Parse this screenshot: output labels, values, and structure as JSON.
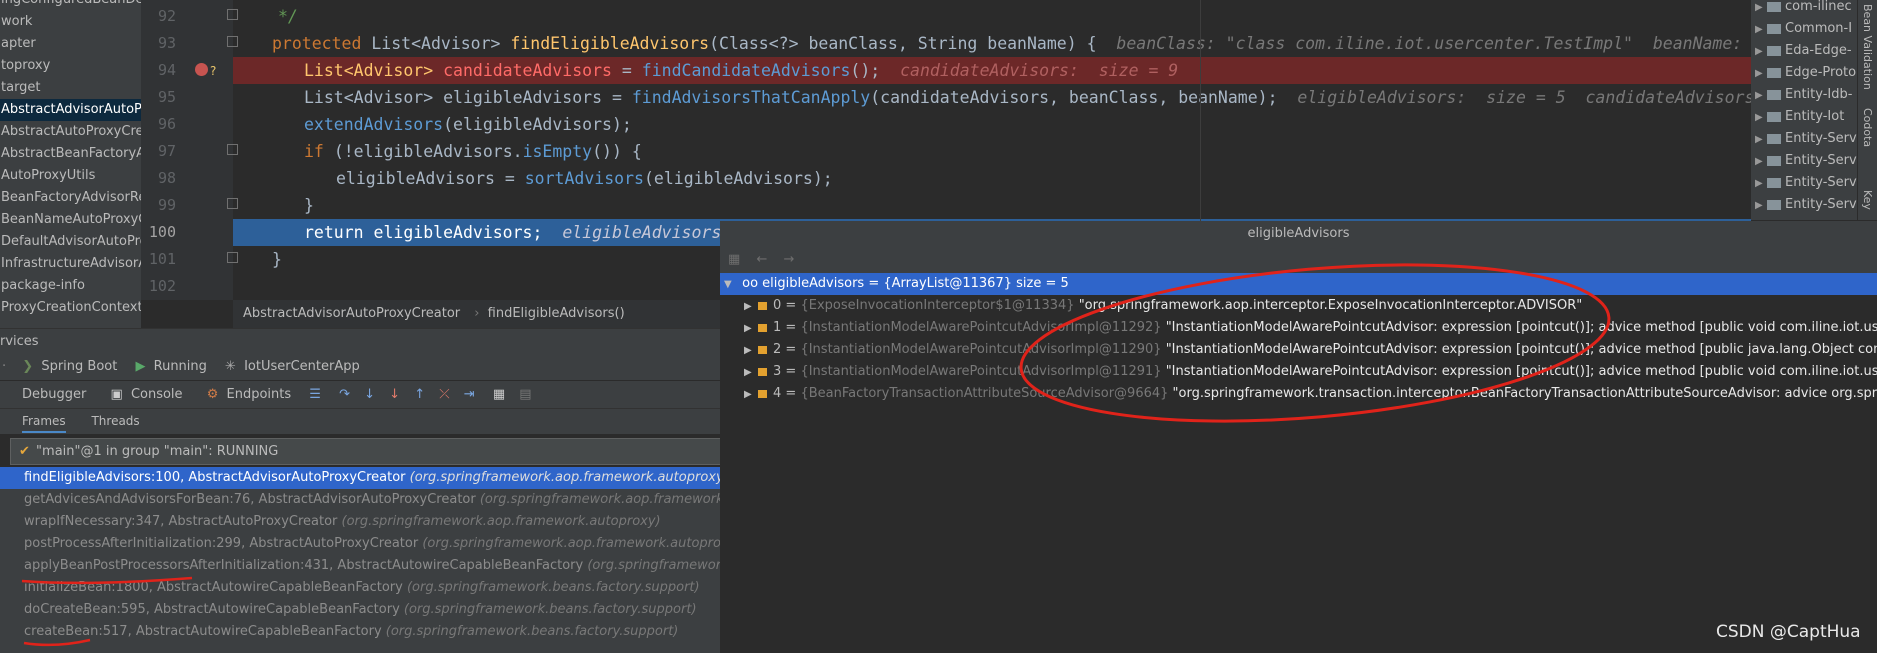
{
  "project_panel": {
    "items": [
      {
        "label": "ingConfiguredBeanDe",
        "selected": false
      },
      {
        "label": "work",
        "selected": false
      },
      {
        "label": "apter",
        "selected": false
      },
      {
        "label": "toproxy",
        "selected": false
      },
      {
        "label": "target",
        "selected": false
      },
      {
        "label": "AbstractAdvisorAutoPr",
        "selected": true
      },
      {
        "label": "AbstractAutoProxyCrea",
        "selected": false
      },
      {
        "label": "AbstractBeanFactoryAd",
        "selected": false
      },
      {
        "label": "AutoProxyUtils",
        "selected": false
      },
      {
        "label": "BeanFactoryAdvisorRet",
        "selected": false
      },
      {
        "label": "BeanNameAutoProxyC",
        "selected": false
      },
      {
        "label": "DefaultAdvisorAutoPro",
        "selected": false
      },
      {
        "label": "InfrastructureAdvisorA",
        "selected": false
      },
      {
        "label": "package-info",
        "selected": false
      },
      {
        "label": "ProxyCreationContext",
        "selected": false
      }
    ]
  },
  "editor": {
    "line_numbers": [
      "92",
      "93",
      "94",
      "95",
      "96",
      "97",
      "98",
      "99",
      "100",
      "101",
      "102"
    ],
    "lines": {
      "l92": "*/",
      "l93_kw": "protected ",
      "l93_type": "List<Advisor> ",
      "l93_fn": "findEligibleAdvisors",
      "l93_params": "(Class<?> beanClass, String beanName) {",
      "l93_hint": "beanClass: \"class com.iline.iot.usercenter.TestImpl\"  beanName: \"",
      "l94_type": "List<Advisor> ",
      "l94_var": "candidateAdvisors",
      "l94_eq": " = ",
      "l94_call": "findCandidateAdvisors",
      "l94_end": "();",
      "l94_hint": "candidateAdvisors:  size = 9",
      "l95_type": "List<Advisor> eligibleAdvisors = ",
      "l95_call": "findAdvisorsThatCanApply",
      "l95_args": "(candidateAdvisors, beanClass, beanName);",
      "l95_hint": "eligibleAdvisors:  size = 5  candidateAdvisors",
      "l96_call": "extendAdvisors",
      "l96_args": "(eligibleAdvisors);",
      "l97_kw": "if ",
      "l97_a": "(!eligibleAdvisors.",
      "l97_call": "isEmpty",
      "l97_b": "()) {",
      "l98_a": "eligibleAdvisors = ",
      "l98_call": "sortAdvisors",
      "l98_b": "(eligibleAdvisors);",
      "l99": "}",
      "l100_kw": "return ",
      "l100_a": "eligibleAdvisors;",
      "l100_hint": "eligibleAdvisors",
      "l101": "}"
    },
    "breadcrumb": [
      "AbstractAdvisorAutoProxyCreator",
      "findEligibleAdvisors()"
    ]
  },
  "right_tree": {
    "items": [
      "com-ilinec",
      "Common-I",
      "Eda-Edge-",
      "Edge-Proto",
      "Entity-Idb-",
      "Entity-Iot",
      "Entity-Serv",
      "Entity-Serv",
      "Entity-Serv",
      "Entity-Serv"
    ],
    "strip_labels": [
      "Bean Validation",
      "Codota",
      "Key"
    ]
  },
  "services": {
    "title": "rvices",
    "run_items": [
      "Spring Boot",
      "Running",
      "IotUserCenterApp"
    ],
    "tabs": [
      "Debugger",
      "Console",
      "Endpoints"
    ],
    "subtabs": [
      "Frames",
      "Threads"
    ],
    "thread": "\"main\"@1 in group \"main\": RUNNING",
    "frames": [
      {
        "method": "findEligibleAdvisors:100, AbstractAdvisorAutoProxyCreator ",
        "pkg": "(org.springframework.aop.framework.autoproxy)",
        "selected": true
      },
      {
        "method": "getAdvicesAndAdvisorsForBean:76, AbstractAdvisorAutoProxyCreator ",
        "pkg": "(org.springframework.aop.framework.autoproxy)",
        "selected": false
      },
      {
        "method": "wrapIfNecessary:347, AbstractAutoProxyCreator ",
        "pkg": "(org.springframework.aop.framework.autoproxy)",
        "selected": false
      },
      {
        "method": "postProcessAfterInitialization:299, AbstractAutoProxyCreator ",
        "pkg": "(org.springframework.aop.framework.autoproxy)",
        "selected": false
      },
      {
        "method": "applyBeanPostProcessorsAfterInitialization:431, AbstractAutowireCapableBeanFactory ",
        "pkg": "(org.springframework.beans.factory.support)",
        "selected": false
      },
      {
        "method": "initializeBean:1800, AbstractAutowireCapableBeanFactory ",
        "pkg": "(org.springframework.beans.factory.support)",
        "selected": false
      },
      {
        "method": "doCreateBean:595, AbstractAutowireCapableBeanFactory ",
        "pkg": "(org.springframework.beans.factory.support)",
        "selected": false
      },
      {
        "method": "createBean:517, AbstractAutowireCapableBeanFactory ",
        "pkg": "(org.springframework.beans.factory.support)",
        "selected": false
      }
    ]
  },
  "variables": {
    "title": "eligibleAdvisors",
    "root": "oo eligibleAdvisors = {ArrayList@11367}  size = 5",
    "items": [
      {
        "index": "0",
        "ref": "{ExposeInvocationInterceptor$1@11334}",
        "value": "\"org.springframework.aop.interceptor.ExposeInvocationInterceptor.ADVISOR\""
      },
      {
        "index": "1",
        "ref": "{InstantiationModelAwarePointcutAdvisorImpl@11292}",
        "value": "\"InstantiationModelAwarePointcutAdvisor: expression [pointcut()]; advice method [public void com.iline.iot.usercenter.r"
      },
      {
        "index": "2",
        "ref": "{InstantiationModelAwarePointcutAdvisorImpl@11290}",
        "value": "\"InstantiationModelAwarePointcutAdvisor: expression [pointcut()]; advice method [public java.lang.Object com.iline.iot.u"
      },
      {
        "index": "3",
        "ref": "{InstantiationModelAwarePointcutAdvisorImpl@11291}",
        "value": "\"InstantiationModelAwarePointcutAdvisor: expression [pointcut()]; advice method [public void com.iline.iot.usercenter.r"
      },
      {
        "index": "4",
        "ref": "{BeanFactoryTransactionAttributeSourceAdvisor@9664}",
        "value": "\"org.springframework.transaction.interceptor.BeanFactoryTransactionAttributeSourceAdvisor: advice org.springframew"
      }
    ]
  },
  "watermark": "CSDN @CaptHua",
  "colors": {
    "annotation_red": "#e0231a",
    "selection_blue": "#2f65ca",
    "breakpoint_line": "#6c2828"
  }
}
